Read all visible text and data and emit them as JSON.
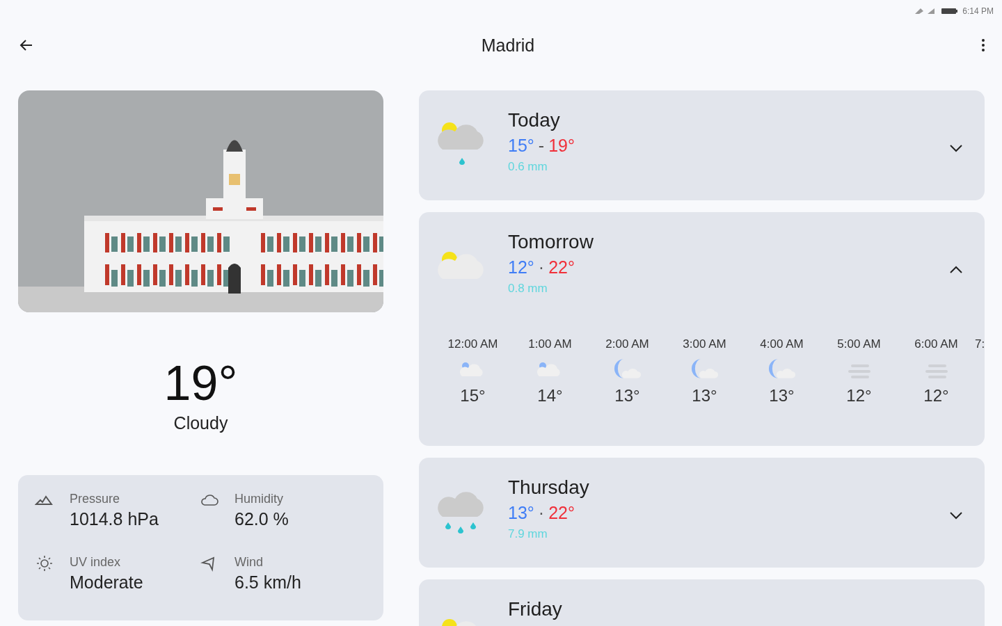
{
  "status_bar": {
    "time": "6:14 PM"
  },
  "header": {
    "title": "Madrid"
  },
  "current": {
    "temperature": "19°",
    "condition": "Cloudy"
  },
  "details": [
    {
      "kind": "pressure",
      "label": "Pressure",
      "value": "1014.8 hPa"
    },
    {
      "kind": "humidity",
      "label": "Humidity",
      "value": "62.0 %"
    },
    {
      "kind": "uv",
      "label": "UV index",
      "value": "Moderate"
    },
    {
      "kind": "wind",
      "label": "Wind",
      "value": "6.5 km/h"
    }
  ],
  "days": [
    {
      "name": "Today",
      "kind": "partly-cloudy-rain",
      "low": "15°",
      "sep": "-",
      "high": "19°",
      "precip": "0.6 mm",
      "expanded": false
    },
    {
      "name": "Tomorrow",
      "kind": "partly-cloudy",
      "low": "12°",
      "sep": "·",
      "high": "22°",
      "precip": "0.8 mm",
      "expanded": true,
      "hours": [
        {
          "time": "12:00 AM",
          "kind": "cloudy-night",
          "temp": "15°"
        },
        {
          "time": "1:00 AM",
          "kind": "cloudy-night",
          "temp": "14°"
        },
        {
          "time": "2:00 AM",
          "kind": "moon-cloud",
          "temp": "13°"
        },
        {
          "time": "3:00 AM",
          "kind": "moon-cloud",
          "temp": "13°"
        },
        {
          "time": "4:00 AM",
          "kind": "moon-cloud",
          "temp": "13°"
        },
        {
          "time": "5:00 AM",
          "kind": "fog",
          "temp": "12°"
        },
        {
          "time": "6:00 AM",
          "kind": "fog",
          "temp": "12°"
        },
        {
          "time": "7:"
        }
      ]
    },
    {
      "name": "Thursday",
      "kind": "rain",
      "low": "13°",
      "sep": "·",
      "high": "22°",
      "precip": "7.9 mm",
      "expanded": false
    },
    {
      "name": "Friday",
      "kind": "partly-cloudy"
    }
  ]
}
